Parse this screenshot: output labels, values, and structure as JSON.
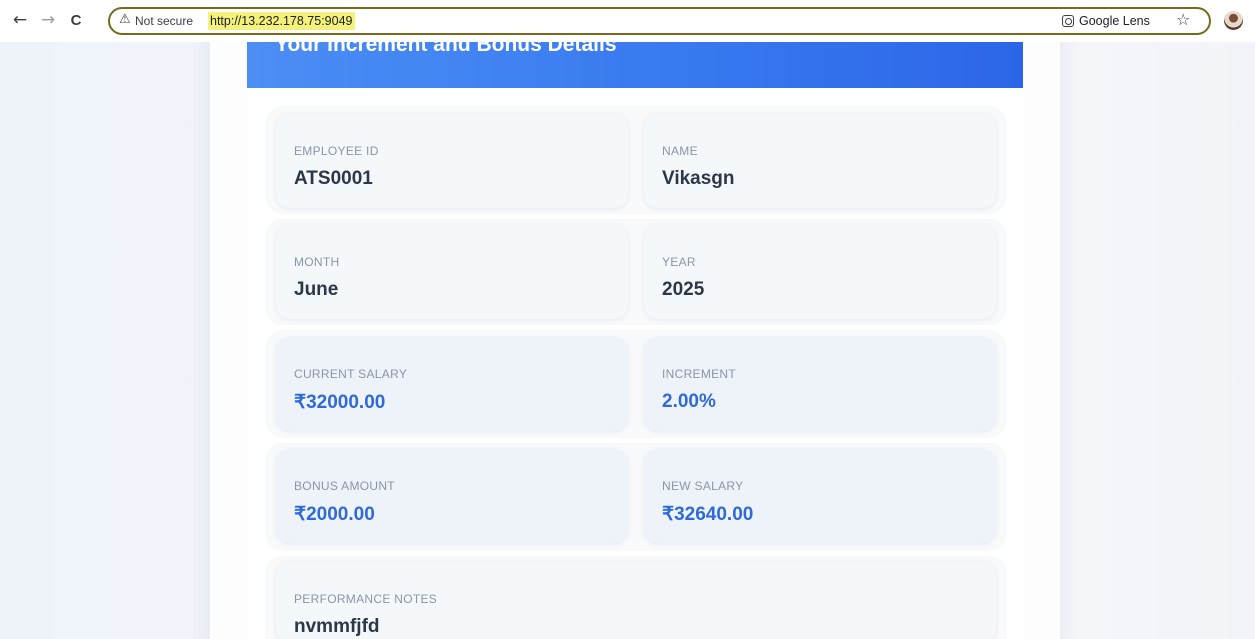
{
  "browser": {
    "security_label": "Not secure",
    "url": "http://13.232.178.75:9049",
    "lens_label": "Google Lens",
    "back_icon": "←",
    "forward_icon": "→",
    "reload_icon": "C",
    "warning_icon": "⚠",
    "bookmark_icon": "☆"
  },
  "header": {
    "title": "Your Increment and Bonus Details"
  },
  "details": {
    "employee_id": {
      "label": "EMPLOYEE ID",
      "value": "ATS0001"
    },
    "name": {
      "label": "NAME",
      "value": "Vikasgn"
    },
    "month": {
      "label": "MONTH",
      "value": "June"
    },
    "year": {
      "label": "YEAR",
      "value": "2025"
    },
    "current_salary": {
      "label": "CURRENT SALARY",
      "value": "₹32000.00"
    },
    "increment": {
      "label": "INCREMENT",
      "value": "2.00%"
    },
    "bonus_amount": {
      "label": "BONUS AMOUNT",
      "value": "₹2000.00"
    },
    "new_salary": {
      "label": "NEW SALARY",
      "value": "₹32640.00"
    },
    "performance_notes": {
      "label": "PERFORMANCE NOTES",
      "value": "nvmmfjfd"
    }
  },
  "colors": {
    "header_start": "#4c8ef4",
    "header_end": "#2c66e8",
    "money_text": "#2f6ad8",
    "label_text": "#8b95a5"
  }
}
